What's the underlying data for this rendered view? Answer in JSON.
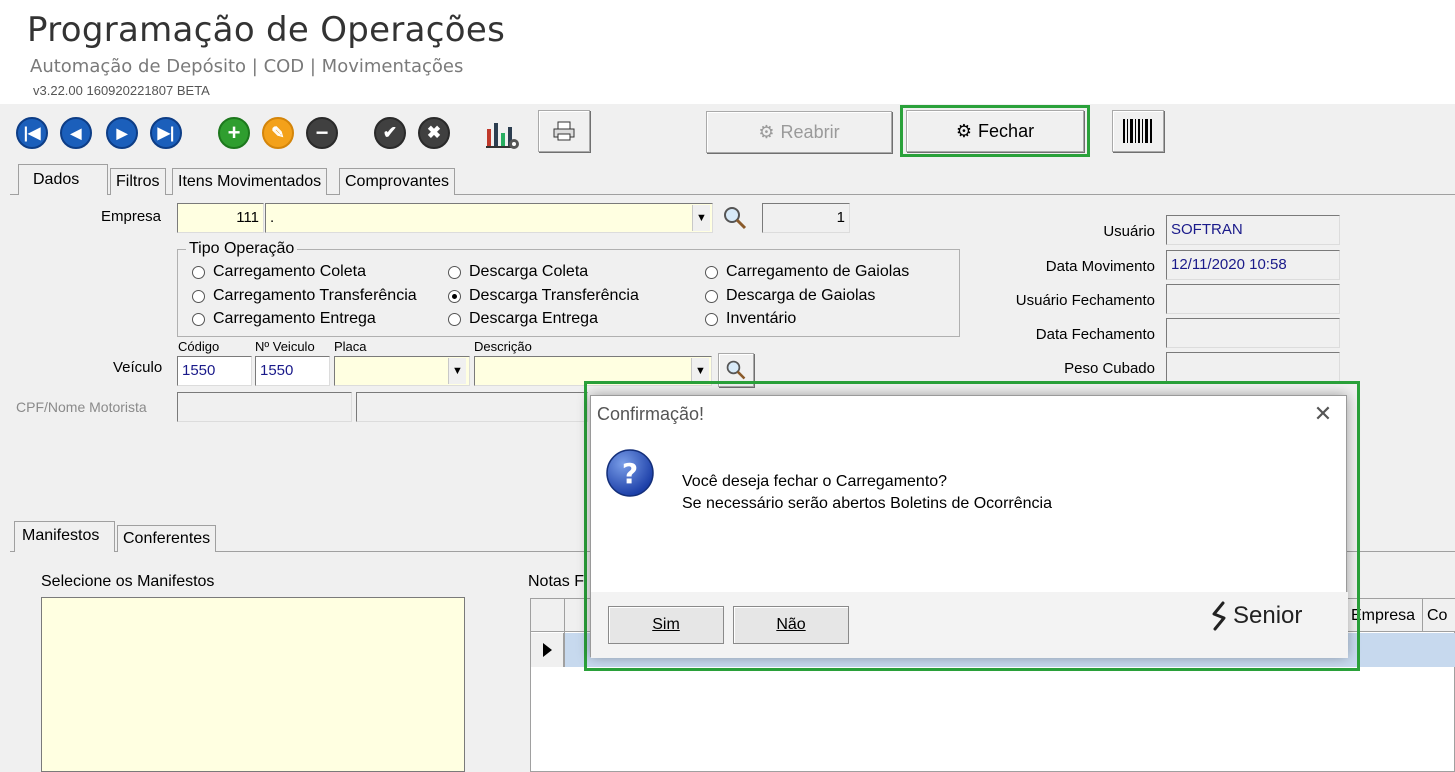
{
  "header": {
    "title": "Programação de Operações",
    "subtitle": "Automação de Depósito | COD | Movimentações",
    "version": "v3.22.00 160920221807 BETA"
  },
  "toolbar": {
    "reabrir_label": "Reabrir",
    "fechar_label": "Fechar"
  },
  "tabs": [
    "Dados",
    "Filtros",
    "Itens Movimentados",
    "Comprovantes"
  ],
  "form": {
    "empresa_label": "Empresa",
    "empresa_code": "111",
    "empresa_name": ".",
    "empresa_count": "1",
    "tipo_operacao_label": "Tipo Operação",
    "operations": [
      {
        "label": "Carregamento Coleta",
        "checked": false
      },
      {
        "label": "Carregamento Transferência",
        "checked": false
      },
      {
        "label": "Carregamento Entrega",
        "checked": false
      },
      {
        "label": "Descarga Coleta",
        "checked": false
      },
      {
        "label": "Descarga Transferência",
        "checked": true
      },
      {
        "label": "Descarga Entrega",
        "checked": false
      },
      {
        "label": "Carregamento de Gaiolas",
        "checked": false
      },
      {
        "label": "Descarga de Gaiolas",
        "checked": false
      },
      {
        "label": "Inventário",
        "checked": false
      }
    ],
    "veiculo_label": "Veículo",
    "codigo_label": "Código",
    "nveiculo_label": "Nº Veiculo",
    "placa_label": "Placa",
    "descricao_label": "Descrição",
    "codigo_value": "1550",
    "nveiculo_value": "1550",
    "cpf_label": "CPF/Nome Motorista"
  },
  "right_panel": {
    "usuario_label": "Usuário",
    "usuario_value": "SOFTRAN",
    "data_movimento_label": "Data Movimento",
    "data_movimento_value": "12/11/2020 10:58",
    "usuario_fechamento_label": "Usuário Fechamento",
    "data_fechamento_label": "Data Fechamento",
    "peso_cubado_label": "Peso Cubado"
  },
  "lower_tabs": [
    "Manifestos",
    "Conferentes"
  ],
  "manifestos": {
    "select_label": "Selecione os Manifestos",
    "notas_label": "Notas Fi",
    "grid_headers": [
      "Empresa",
      "Co"
    ]
  },
  "dialog": {
    "title": "Confirmação!",
    "line1": "Você deseja fechar o Carregamento?",
    "line2": "Se necessário serão abertos Boletins de Ocorrência",
    "yes_label": "Sim",
    "no_label": "Não",
    "brand": "Senior"
  },
  "colors": {
    "highlight": "#2aa13a",
    "nav_blue": "#1b5fbb",
    "input_yellow": "#ffffe1"
  }
}
